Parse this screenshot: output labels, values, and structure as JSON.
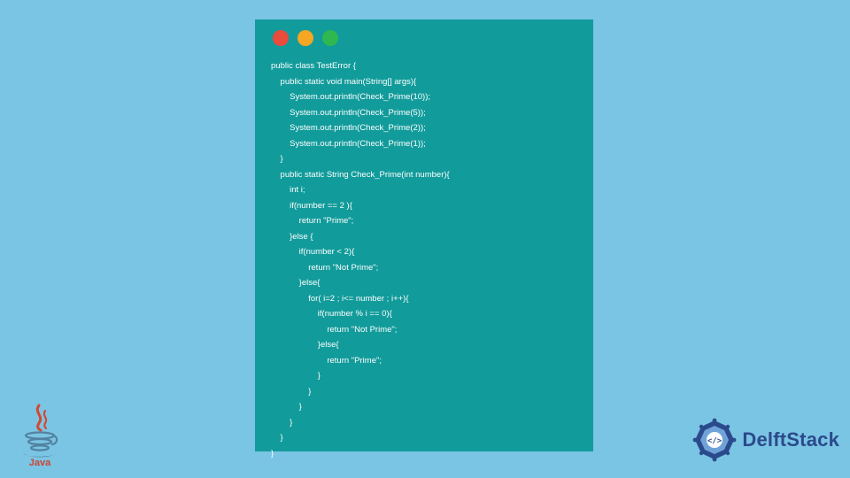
{
  "window": {
    "dots": {
      "red": "#e94b3c",
      "yellow": "#f5a623",
      "green": "#2fb84f"
    }
  },
  "code": {
    "lines": [
      "public class TestError {",
      "    public static void main(String[] args){",
      "        System.out.println(Check_Prime(10));",
      "        System.out.println(Check_Prime(5));",
      "        System.out.println(Check_Prime(2));",
      "        System.out.println(Check_Prime(1));",
      "    }",
      "    public static String Check_Prime(int number){",
      "        int i;",
      "        if(number == 2 ){",
      "            return \"Prime\";",
      "        }else {",
      "            if(number < 2){",
      "                return \"Not Prime\";",
      "            }else{",
      "                for( i=2 ; i<= number ; i++){",
      "                    if(number % i == 0){",
      "                        return \"Not Prime\";",
      "                    }else{",
      "                        return \"Prime\";",
      "                    }",
      "                }",
      "            }",
      "        }",
      "    }",
      "}"
    ]
  },
  "logos": {
    "java_label": "Java",
    "delft_label": "DelftStack"
  },
  "colors": {
    "page_bg": "#7bc5e4",
    "window_bg": "#129b9b",
    "code_fg": "#ffffff",
    "delft_blue": "#2b4a8b",
    "java_red": "#d34832",
    "java_blue": "#5382a1"
  }
}
